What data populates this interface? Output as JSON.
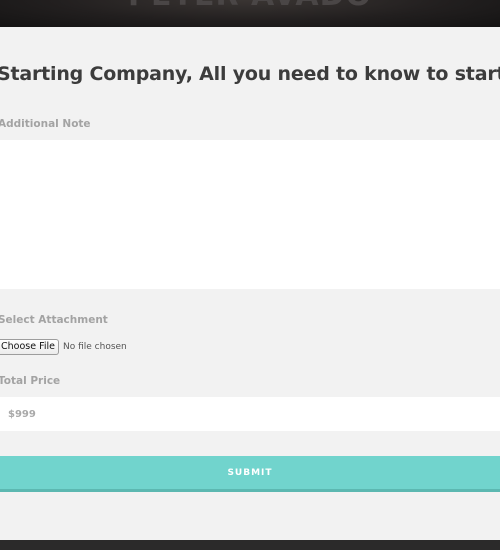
{
  "hero": {
    "title": "PETER AVADO"
  },
  "form": {
    "heading": "Starting Company, All you need to know to start company",
    "note_label": "Additional Note",
    "note_value": "",
    "attachment_label": "Select Attachment",
    "choose_file_label": "Choose File",
    "file_status": "No file chosen",
    "price_label": "Total Price",
    "price_value": "$999",
    "submit_label": "SUBMIT"
  },
  "colors": {
    "accent": "#71d4cd",
    "panel_background": "#f2f2f2",
    "dark_background": "#1e1c1d"
  }
}
